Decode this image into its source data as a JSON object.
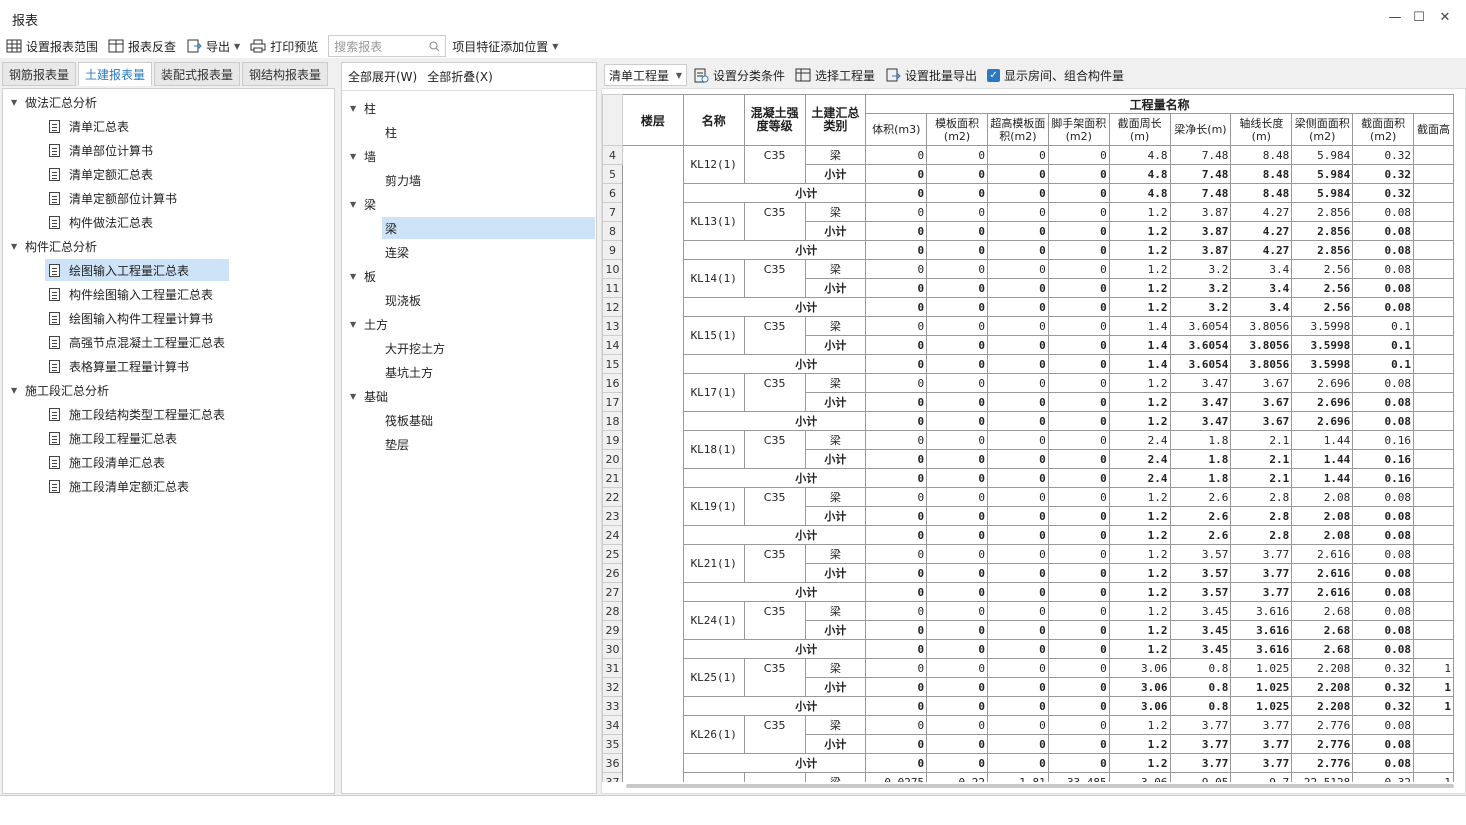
{
  "window": {
    "title": "报表"
  },
  "toolbar": {
    "set_range": "设置报表范围",
    "reverse_check": "报表反查",
    "export": "导出",
    "print_preview": "打印预览",
    "search_placeholder": "搜索报表",
    "feature_pos": "项目特征添加位置"
  },
  "tabs": [
    "钢筋报表量",
    "土建报表量",
    "装配式报表量",
    "钢结构报表量"
  ],
  "left_tree": [
    {
      "type": "group",
      "label": "做法汇总分析"
    },
    {
      "type": "item",
      "label": "清单汇总表"
    },
    {
      "type": "item",
      "label": "清单部位计算书"
    },
    {
      "type": "item",
      "label": "清单定额汇总表"
    },
    {
      "type": "item",
      "label": "清单定额部位计算书"
    },
    {
      "type": "item",
      "label": "构件做法汇总表"
    },
    {
      "type": "group",
      "label": "构件汇总分析"
    },
    {
      "type": "item",
      "label": "绘图输入工程量汇总表",
      "selected": true
    },
    {
      "type": "item",
      "label": "构件绘图输入工程量汇总表"
    },
    {
      "type": "item",
      "label": "绘图输入构件工程量计算书"
    },
    {
      "type": "item",
      "label": "高强节点混凝土工程量汇总表"
    },
    {
      "type": "item",
      "label": "表格算量工程量计算书"
    },
    {
      "type": "group",
      "label": "施工段汇总分析"
    },
    {
      "type": "item",
      "label": "施工段结构类型工程量汇总表"
    },
    {
      "type": "item",
      "label": "施工段工程量汇总表"
    },
    {
      "type": "item",
      "label": "施工段清单汇总表"
    },
    {
      "type": "item",
      "label": "施工段清单定额汇总表"
    }
  ],
  "mid": {
    "expand_all": "全部展开(W)",
    "collapse_all": "全部折叠(X)",
    "tree": [
      {
        "type": "group",
        "label": "柱"
      },
      {
        "type": "item",
        "label": "柱"
      },
      {
        "type": "group",
        "label": "墙"
      },
      {
        "type": "item",
        "label": "剪力墙"
      },
      {
        "type": "group",
        "label": "梁"
      },
      {
        "type": "item",
        "label": "梁",
        "selected": true
      },
      {
        "type": "item",
        "label": "连梁"
      },
      {
        "type": "group",
        "label": "板"
      },
      {
        "type": "item",
        "label": "现浇板"
      },
      {
        "type": "group",
        "label": "土方"
      },
      {
        "type": "item",
        "label": "大开挖土方"
      },
      {
        "type": "item",
        "label": "基坑土方"
      },
      {
        "type": "group",
        "label": "基础"
      },
      {
        "type": "item",
        "label": "筏板基础"
      },
      {
        "type": "item",
        "label": "垫层"
      }
    ]
  },
  "right_toolbar": {
    "select_value": "清单工程量",
    "set_category": "设置分类条件",
    "select_project": "选择工程量",
    "batch_export": "设置批量导出",
    "show_rooms": "显示房间、组合构件量"
  },
  "table": {
    "headers": {
      "floor": "楼层",
      "name": "名称",
      "grade": "混凝土强度等级",
      "category": "土建汇总类别",
      "qty_group": "工程量名称",
      "cols": [
        "体积(m3)",
        "模板面积(m2)",
        "超高模板面积(m2)",
        "脚手架面积(m2)",
        "截面周长(m)",
        "梁净长(m)",
        "轴线长度(m)",
        "梁侧面面积(m2)",
        "截面面积(m2)",
        "截面高"
      ]
    },
    "beam_label": "梁",
    "subtotal_label": "小计",
    "groups": [
      {
        "rows": [
          4,
          5,
          6
        ],
        "name": "KL12(1)",
        "grade": "C35",
        "v": [
          "0",
          "0",
          "0",
          "0",
          "4.8",
          "7.48",
          "8.48",
          "5.984",
          "0.32",
          ""
        ]
      },
      {
        "rows": [
          7,
          8,
          9
        ],
        "name": "KL13(1)",
        "grade": "C35",
        "v": [
          "0",
          "0",
          "0",
          "0",
          "1.2",
          "3.87",
          "4.27",
          "2.856",
          "0.08",
          ""
        ]
      },
      {
        "rows": [
          10,
          11,
          12
        ],
        "name": "KL14(1)",
        "grade": "C35",
        "v": [
          "0",
          "0",
          "0",
          "0",
          "1.2",
          "3.2",
          "3.4",
          "2.56",
          "0.08",
          ""
        ]
      },
      {
        "rows": [
          13,
          14,
          15
        ],
        "name": "KL15(1)",
        "grade": "C35",
        "v": [
          "0",
          "0",
          "0",
          "0",
          "1.4",
          "3.6054",
          "3.8056",
          "3.5998",
          "0.1",
          ""
        ]
      },
      {
        "rows": [
          16,
          17,
          18
        ],
        "name": "KL17(1)",
        "grade": "C35",
        "v": [
          "0",
          "0",
          "0",
          "0",
          "1.2",
          "3.47",
          "3.67",
          "2.696",
          "0.08",
          ""
        ]
      },
      {
        "rows": [
          19,
          20,
          21
        ],
        "name": "KL18(1)",
        "grade": "C35",
        "v": [
          "0",
          "0",
          "0",
          "0",
          "2.4",
          "1.8",
          "2.1",
          "1.44",
          "0.16",
          ""
        ]
      },
      {
        "rows": [
          22,
          23,
          24
        ],
        "name": "KL19(1)",
        "grade": "C35",
        "v": [
          "0",
          "0",
          "0",
          "0",
          "1.2",
          "2.6",
          "2.8",
          "2.08",
          "0.08",
          ""
        ]
      },
      {
        "rows": [
          25,
          26,
          27
        ],
        "name": "KL21(1)",
        "grade": "C35",
        "v": [
          "0",
          "0",
          "0",
          "0",
          "1.2",
          "3.57",
          "3.77",
          "2.616",
          "0.08",
          ""
        ]
      },
      {
        "rows": [
          28,
          29,
          30
        ],
        "name": "KL24(1)",
        "grade": "C35",
        "v": [
          "0",
          "0",
          "0",
          "0",
          "1.2",
          "3.45",
          "3.616",
          "2.68",
          "0.08",
          ""
        ]
      },
      {
        "rows": [
          31,
          32,
          33
        ],
        "name": "KL25(1)",
        "grade": "C35",
        "v": [
          "0",
          "0",
          "0",
          "0",
          "3.06",
          "0.8",
          "1.025",
          "2.208",
          "0.32",
          "1"
        ]
      },
      {
        "rows": [
          34,
          35,
          36
        ],
        "name": "KL26(1)",
        "grade": "C35",
        "v": [
          "0",
          "0",
          "0",
          "0",
          "1.2",
          "3.77",
          "3.77",
          "2.776",
          "0.08",
          ""
        ]
      }
    ],
    "partial_row": {
      "row": 37,
      "v": [
        "0.0275",
        "0.22",
        "1.81",
        "33.485",
        "3.06",
        "9.05",
        "9.7",
        "22.5128",
        "0.32",
        "1"
      ]
    }
  }
}
